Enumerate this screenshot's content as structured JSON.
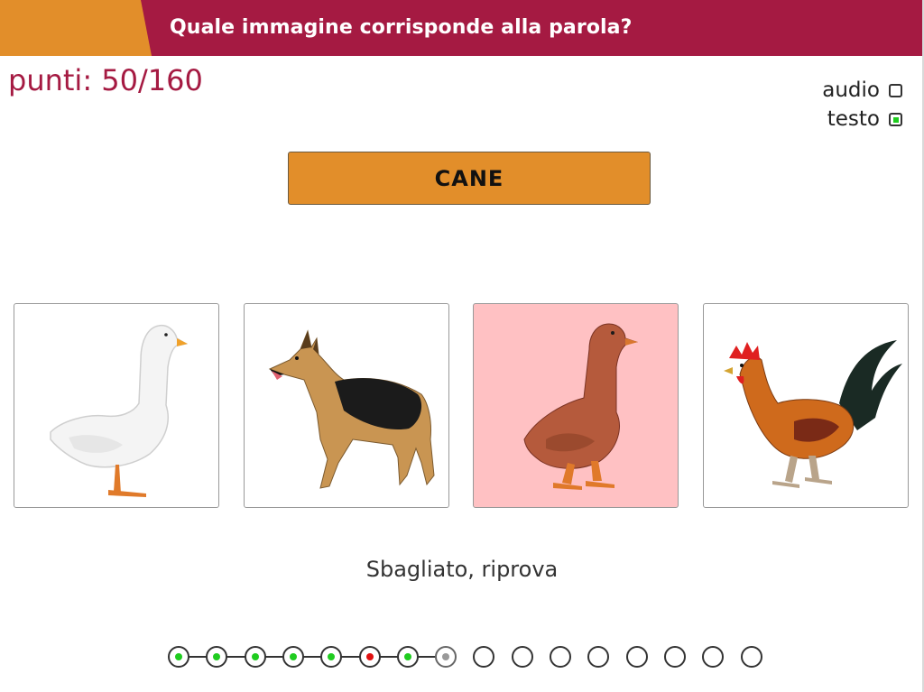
{
  "header": {
    "question": "Quale immagine corrisponde alla parola?"
  },
  "score": {
    "label": "punti: 50/160"
  },
  "options": {
    "audio": {
      "label": "audio",
      "checked": false
    },
    "text": {
      "label": "testo",
      "checked": true
    }
  },
  "word": "CANE",
  "choices": [
    {
      "animal": "goose",
      "state": "neutral"
    },
    {
      "animal": "dog",
      "state": "neutral"
    },
    {
      "animal": "duck",
      "state": "wrong"
    },
    {
      "animal": "rooster",
      "state": "neutral"
    }
  ],
  "feedback": "Sbagliato, riprova",
  "progress": {
    "total": 16,
    "states": [
      "correct",
      "correct",
      "correct",
      "correct",
      "correct",
      "wrong",
      "correct",
      "current",
      "empty",
      "empty",
      "empty",
      "empty",
      "empty",
      "empty",
      "empty",
      "empty"
    ]
  },
  "colors": {
    "brand": "#a51a42",
    "accent": "#e28e2a",
    "correct": "#1fcc1f",
    "wrong": "#e01010",
    "wrong_card": "#ffc1c3"
  }
}
